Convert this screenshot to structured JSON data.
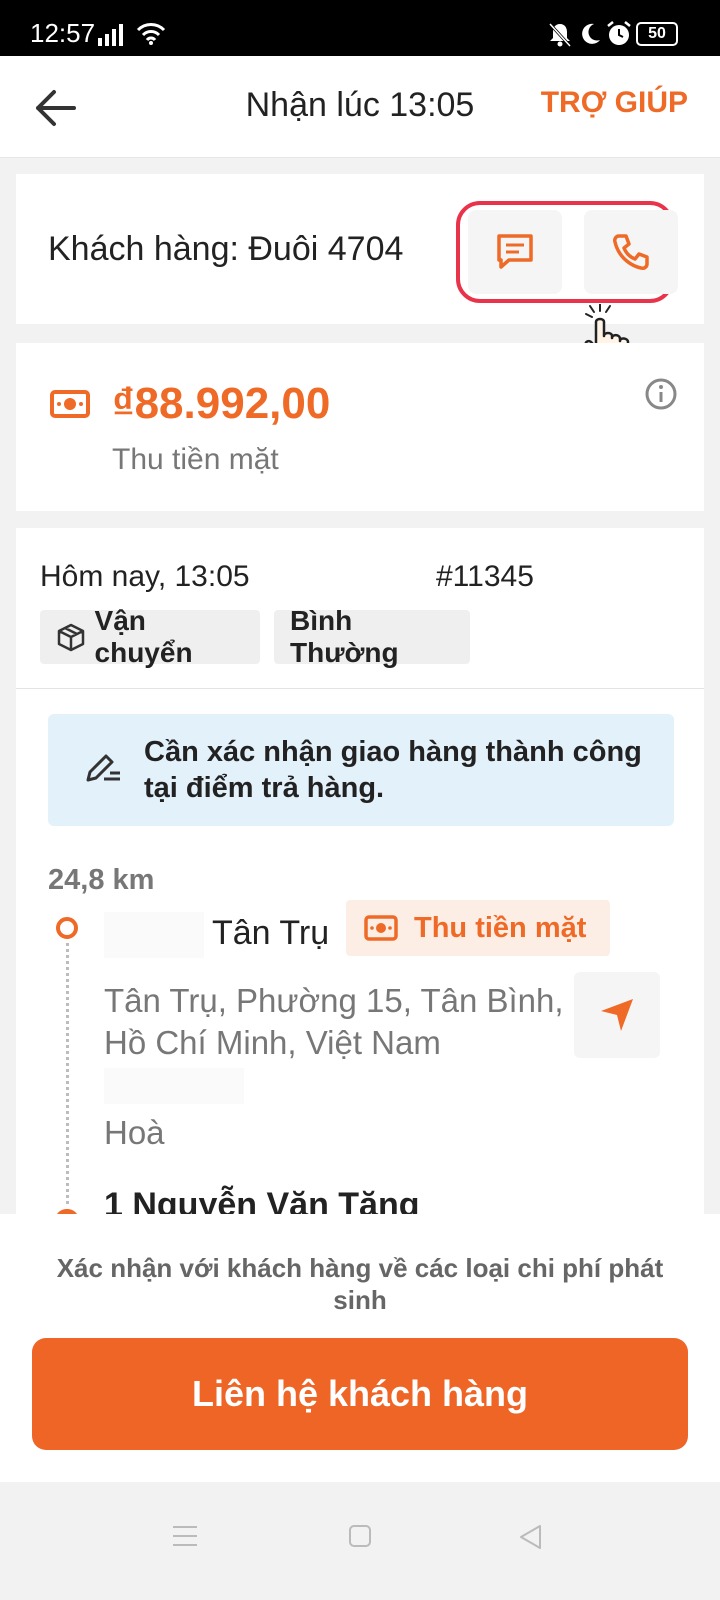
{
  "status_bar": {
    "time": "12:57",
    "battery": "50",
    "icons": [
      "signal-icon",
      "wifi-icon",
      "mute-icon",
      "moon-icon",
      "alarm-icon",
      "battery-icon"
    ]
  },
  "header": {
    "title": "Nhận lúc 13:05",
    "help_label": "TRỢ GIÚP"
  },
  "customer": {
    "label": "Khách hàng: Đuôi 4704",
    "highlight_color": "#e8334a"
  },
  "payment": {
    "amount": "₫88.992,00",
    "method": "Thu tiền mặt"
  },
  "order": {
    "time": "Hôm nay, 13:05",
    "id": "#11345",
    "tags": [
      "Vận chuyển",
      "Bình Thường"
    ]
  },
  "notice": {
    "text": "Cần xác nhận giao hàng thành công tại điểm trả hàng."
  },
  "route": {
    "distance": "24,8 km",
    "pickup": {
      "name": "Tân Trụ",
      "payment_badge": "Thu tiền mặt",
      "address": "Tân Trụ, Phường 15, Tân Bình, Hồ Chí Minh, Việt Nam",
      "note": "Hoà"
    },
    "dropoff": {
      "name": "1 Nguyễn Văn Tăng"
    }
  },
  "footer": {
    "confirm_note": "Xác nhận với khách hàng về các loại chi phí phát sinh",
    "contact_button": "Liên hệ khách hàng"
  },
  "theme": {
    "accent": "#ee6a26",
    "notice_bg": "#e3f1fb"
  }
}
